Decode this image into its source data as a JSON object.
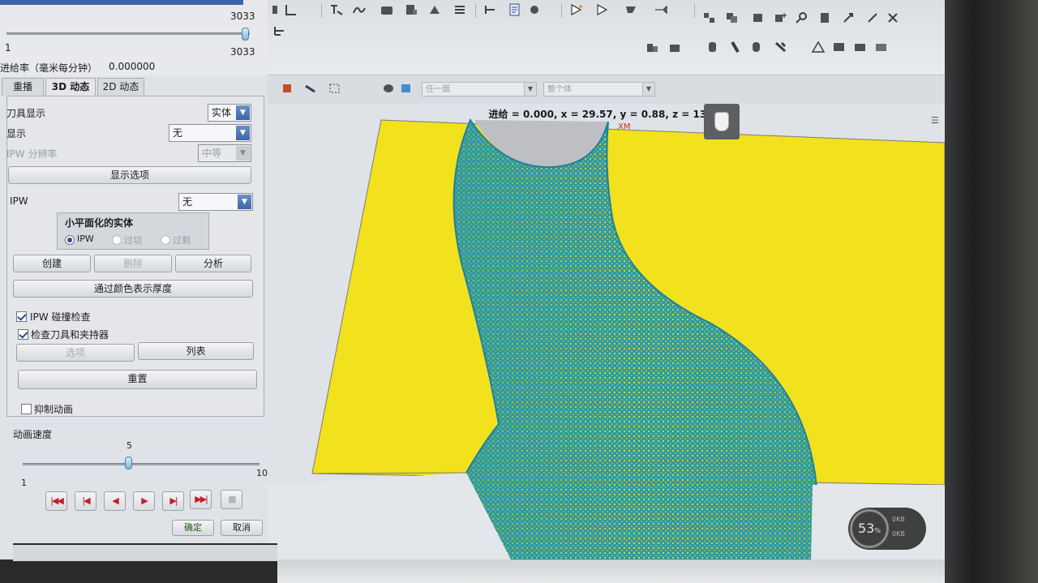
{
  "toolbar": {
    "select_1": {
      "value": "任一面"
    },
    "select_2": {
      "value": "整个体"
    }
  },
  "viewport": {
    "status": "进给 = 0.000, x = 29.57, y = 0.88, z = 13.20",
    "axis_label": "XM",
    "timer": {
      "value": "53",
      "unit": "%",
      "line1": "0KB",
      "line2": "0KB"
    }
  },
  "panel": {
    "slider_top": {
      "max_label": "3033",
      "min_label": "1",
      "value_label": "3033"
    },
    "feed_rate": {
      "label": "进给率（毫米每分钟）",
      "value": "0.000000"
    },
    "tabs": [
      {
        "label": "重播"
      },
      {
        "label": "3D 动态"
      },
      {
        "label": "2D 动态"
      }
    ],
    "tool_display": {
      "label": "刀具显示",
      "value": "实体"
    },
    "display": {
      "label": "显示",
      "value": "无"
    },
    "ipw_resolution": {
      "label": "IPW 分辨率",
      "value": "中等"
    },
    "display_options_button": "显示选项",
    "ipw": {
      "label": "IPW",
      "value": "无"
    },
    "facet_group": {
      "title": "小平面化的实体",
      "options": [
        {
          "label": "IPW",
          "selected": true
        },
        {
          "label": "过切",
          "selected": false
        },
        {
          "label": "过剩",
          "selected": false
        }
      ]
    },
    "buttons_row": {
      "create": "创建",
      "delete": "删除",
      "analyze": "分析"
    },
    "thickness_button": "通过颜色表示厚度",
    "ipw_collision": {
      "label": "IPW 碰撞检查",
      "checked": true
    },
    "check_tool_holder": {
      "label": "检查刀具和夹持器",
      "checked": true
    },
    "options_button": "选项",
    "list_button": "列表",
    "reset_button": "重置",
    "suppress_animation": {
      "label": "抑制动画",
      "checked": false
    },
    "animation_speed": {
      "label": "动画速度",
      "value": 5,
      "min": "1",
      "max": "10",
      "value_label": "5"
    },
    "playback": [
      "|◀◀",
      "|◀",
      "◀",
      "▶",
      "▶|",
      "▶▶|",
      "■"
    ],
    "ok_button": "确定",
    "cancel_button": "取消"
  },
  "colors": {
    "stock": "#f2e11d",
    "toolpath": "#2f9aa2",
    "accent": "#3d66a8"
  }
}
